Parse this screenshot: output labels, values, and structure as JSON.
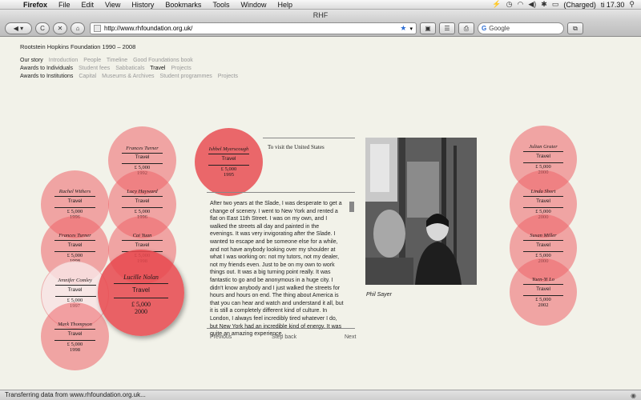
{
  "menubar": {
    "app": "Firefox",
    "items": [
      "File",
      "Edit",
      "View",
      "History",
      "Bookmarks",
      "Tools",
      "Window",
      "Help"
    ],
    "battery": "(Charged)",
    "clock": "ti 17.30"
  },
  "window": {
    "title": "RHF"
  },
  "toolbar": {
    "back": "◀ ▾",
    "reload": "C",
    "stop": "✕",
    "home": "⌂",
    "url": "http://www.rhfoundation.org.uk/",
    "search_placeholder": "Google"
  },
  "site": {
    "title": "Rootstein Hopkins Foundation 1990 – 2008",
    "nav": [
      {
        "lead": "Our story",
        "items": [
          "Introduction",
          "People",
          "Timeline",
          "Good Foundations book"
        ]
      },
      {
        "lead": "Awards to Individuals",
        "items": [
          "Student fees",
          "Sabbaticals",
          "Travel",
          "Projects"
        ]
      },
      {
        "lead": "Awards to Institutions",
        "items": [
          "Capital",
          "Museums & Archives",
          "Student programmes",
          "Projects"
        ]
      }
    ]
  },
  "circles": {
    "frances_turner_top": {
      "name": "Frances Turner",
      "tag": "Travel",
      "amount": "£ 5,000",
      "year": "1992"
    },
    "rachel_withers": {
      "name": "Rachel Withers",
      "tag": "Travel",
      "amount": "£ 5,000",
      "year": "1996"
    },
    "lucy_hayward": {
      "name": "Lucy Hayward",
      "tag": "Travel",
      "amount": "£ 5,000",
      "year": "1996"
    },
    "frances_turner_mid": {
      "name": "Frances Turner",
      "tag": "Travel",
      "amount": "£ 5,000",
      "year": "1998"
    },
    "cai_yuan": {
      "name": "Cai Yuan",
      "tag": "Travel",
      "amount": "£ 5,000",
      "year": "1998"
    },
    "jennifer_comley": {
      "name": "Jennifer Comley",
      "tag": "Travel",
      "amount": "£ 5,000",
      "year": "1997"
    },
    "lucille_nolan": {
      "name": "Lucille Nolan",
      "tag": "Travel",
      "amount": "£ 5,000",
      "year": "2000"
    },
    "mark_thompson": {
      "name": "Mark Thompson",
      "tag": "Travel",
      "amount": "£ 5,000",
      "year": "1998"
    },
    "ishbel_myerscough": {
      "name": "Ishbel Myerscough",
      "tag": "Travel",
      "amount": "£ 5,000",
      "year": "1995"
    },
    "julian_grater": {
      "name": "Julian Grater",
      "tag": "Travel",
      "amount": "£ 5,000",
      "year": "2000"
    },
    "linda_short": {
      "name": "Linda Short",
      "tag": "Travel",
      "amount": "£ 5,000",
      "year": "2000"
    },
    "susan_miller": {
      "name": "Susan Miller",
      "tag": "Travel",
      "amount": "£ 5,000",
      "year": "2000"
    },
    "yuen_yi_lo": {
      "name": "Yuen-Yi Lo",
      "tag": "Travel",
      "amount": "£ 5,000",
      "year": "2002"
    }
  },
  "story": {
    "purpose": "To visit the United States",
    "text": "After two years at the Slade, I was desperate to get a change of scenery. I went to New York and rented a flat on East 11th Street. I was on my own, and I walked the streets all day and painted in the evenings. It was very invigorating after the Slade. I wanted to escape and be someone else for a while, and not have anybody looking over my shoulder at what I was working on: not my tutors, not my dealer, not my friends even. Just to be on my own to work things out. It was a big turning point really. It was fantastic to go and be anonymous in a huge city. I didn't know anybody and I just walked the streets for hours and hours on end. The thing about America is that you can hear and watch and understand it all, but it is still a completely different kind of culture. In London, I always feel incredibly tired whatever I do, but New York had an incredible kind of energy. It was quite an amazing experience.",
    "previous": "Previous",
    "step_back": "Step back",
    "next": "Next"
  },
  "photo": {
    "caption": "Phil Sayer"
  },
  "statusbar": {
    "text": "Transferring data from www.rhfoundation.org.uk..."
  }
}
